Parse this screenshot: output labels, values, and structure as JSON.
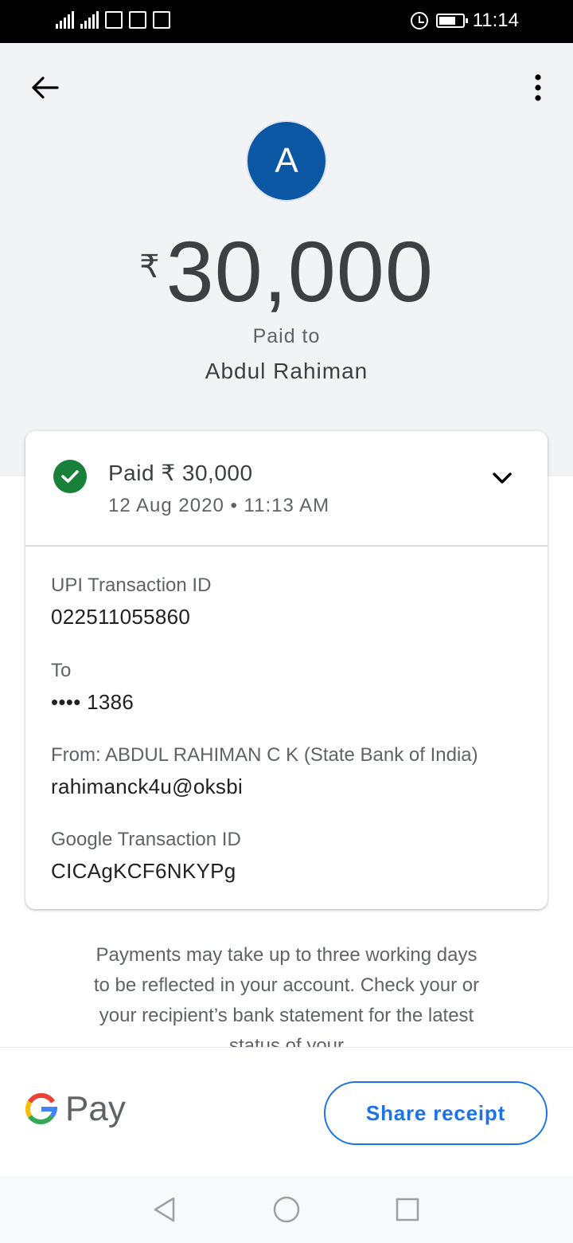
{
  "status_bar": {
    "time": "11:14"
  },
  "header": {
    "avatar_letter": "A",
    "currency_symbol": "₹",
    "amount": "30,000",
    "paid_to_label": "Paid to",
    "payee_name": "Abdul Rahiman"
  },
  "card": {
    "status": "Paid ₹ 30,000",
    "date": "12 Aug 2020 • 11:13 AM",
    "details": [
      {
        "label": "UPI Transaction ID",
        "value": "022511055860"
      },
      {
        "label": "To",
        "value": "•••• 1386"
      },
      {
        "label": "From: ABDUL RAHIMAN  C K (State Bank of India)",
        "value": "rahimanck4u@oksbi"
      },
      {
        "label": "Google Transaction ID",
        "value": "CICAgKCF6NKYPg"
      }
    ]
  },
  "info_text": "Payments may take up to three working days to be reflected in your account. Check your or your recipient’s bank statement for the latest status of your",
  "footer": {
    "brand_letter": "G",
    "brand": "Pay",
    "share_label": "Share receipt"
  },
  "colors": {
    "header_bg": "#f1f3f4",
    "avatar": "#0b57a4",
    "success": "#188038",
    "accent": "#1a73e8"
  },
  "icons": {
    "back": "arrow-left-icon",
    "more": "more-vert-icon",
    "status": "check-circle-icon",
    "expand": "chevron-down-icon",
    "nav_back": "triangle-back-icon",
    "nav_home": "circle-home-icon",
    "nav_recents": "square-recents-icon"
  }
}
